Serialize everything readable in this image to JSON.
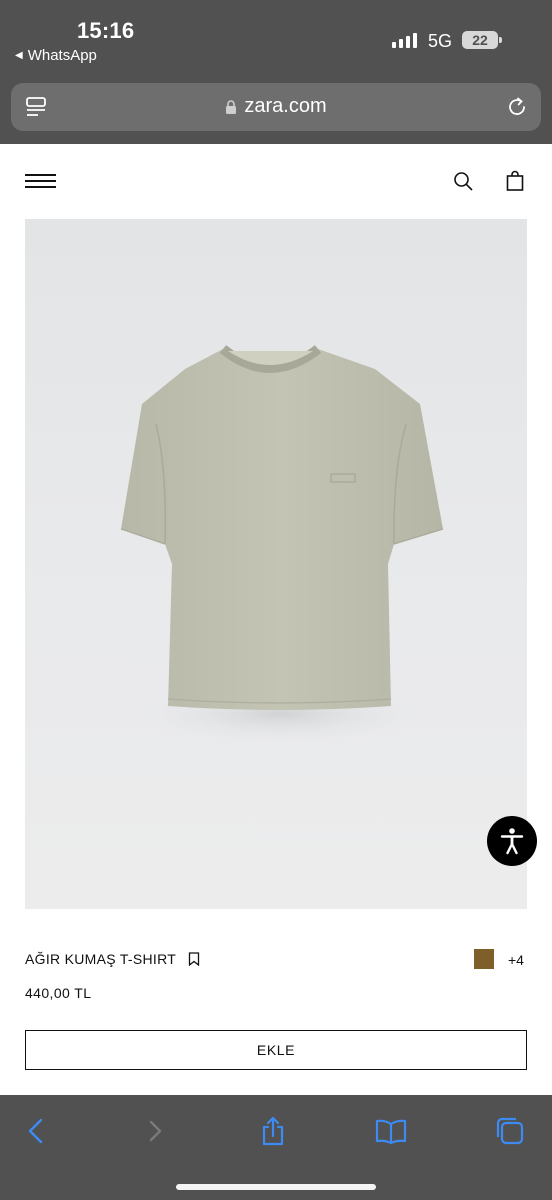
{
  "status_bar": {
    "time": "15:16",
    "back_app": "WhatsApp",
    "network": "5G",
    "battery": "22"
  },
  "browser": {
    "url": "zara.com",
    "colors": {
      "chrome": "#515151",
      "urlbar": "#6e6e6e",
      "icon_blue": "#3d8bf2"
    }
  },
  "header": {
    "menu_icon": "hamburger-menu-icon",
    "search_icon": "search-icon",
    "bag_icon": "shopping-bag-icon"
  },
  "product": {
    "name": "AĞIR KUMAŞ T-SHIRT",
    "price": "440,00 TL",
    "swatch_color": "#7f5f29",
    "more_colors": "+4",
    "add_label": "EKLE"
  },
  "toolbar": {
    "icons": [
      "back-icon",
      "forward-icon",
      "share-icon",
      "bookmarks-icon",
      "tabs-icon"
    ]
  }
}
